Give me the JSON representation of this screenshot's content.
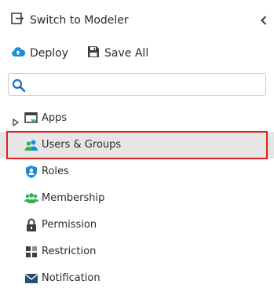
{
  "header": {
    "switch_label": "Switch to Modeler"
  },
  "toolbar": {
    "deploy_label": "Deploy",
    "save_all_label": "Save All"
  },
  "search": {
    "value": "",
    "placeholder": ""
  },
  "tree": {
    "items": [
      {
        "label": "Apps",
        "icon": "apps-window-icon",
        "expandable": true
      },
      {
        "label": "Users & Groups",
        "icon": "users-groups-icon",
        "selected": true
      },
      {
        "label": "Roles",
        "icon": "shield-user-icon"
      },
      {
        "label": "Membership",
        "icon": "membership-group-icon"
      },
      {
        "label": "Permission",
        "icon": "lock-icon"
      },
      {
        "label": "Restriction",
        "icon": "restriction-grid-icon"
      },
      {
        "label": "Notification",
        "icon": "envelope-icon"
      }
    ]
  },
  "colors": {
    "selection_outline": "#e02020",
    "selected_row_bg": "#e6e6e6",
    "accent_blue": "#1a8fd9",
    "accent_green": "#2fae56",
    "icon_dark": "#3a3f44"
  }
}
